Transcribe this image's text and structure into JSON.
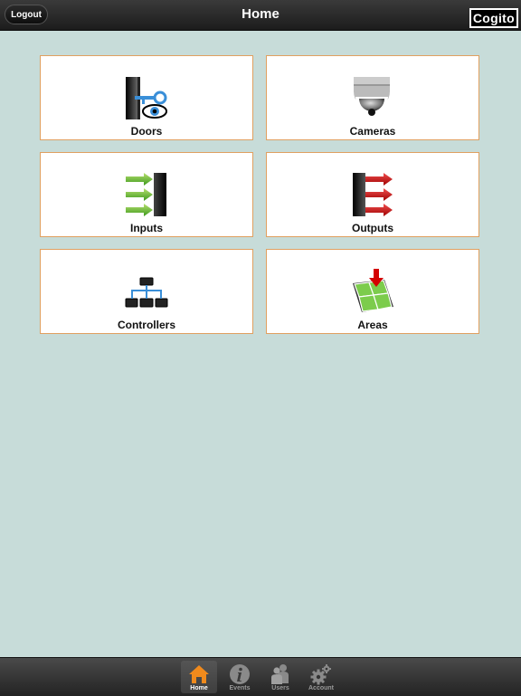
{
  "header": {
    "logout_label": "Logout",
    "title": "Home",
    "logo_text": "Cogito"
  },
  "tiles": [
    {
      "label": "Doors",
      "icon": "door-key-eye-icon"
    },
    {
      "label": "Cameras",
      "icon": "dome-camera-icon"
    },
    {
      "label": "Inputs",
      "icon": "green-arrows-in-icon"
    },
    {
      "label": "Outputs",
      "icon": "red-arrows-out-icon"
    },
    {
      "label": "Controllers",
      "icon": "network-hierarchy-icon"
    },
    {
      "label": "Areas",
      "icon": "map-area-icon"
    }
  ],
  "tabbar": {
    "tabs": [
      {
        "label": "Home",
        "icon": "home-icon",
        "active": true
      },
      {
        "label": "Events",
        "icon": "info-icon",
        "active": false
      },
      {
        "label": "Users",
        "icon": "users-icon",
        "active": false
      },
      {
        "label": "Account",
        "icon": "gear-icon",
        "active": false
      }
    ],
    "active_color": "#f08a1c"
  }
}
